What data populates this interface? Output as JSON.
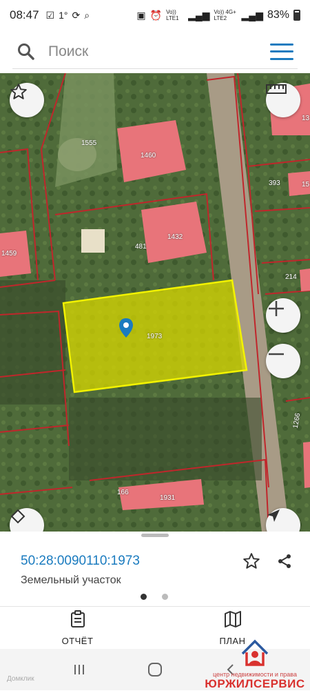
{
  "status_bar": {
    "time": "08:47",
    "temp": "1°",
    "sim1": "Vo)) LTE1",
    "sim2": "Vo)) 4G+ LTE2",
    "battery": "83%"
  },
  "search": {
    "placeholder": "Поиск"
  },
  "map": {
    "parcels": [
      {
        "label": "1555"
      },
      {
        "label": "1460"
      },
      {
        "label": "1432"
      },
      {
        "label": "481"
      },
      {
        "label": "1459"
      },
      {
        "label": "1973"
      },
      {
        "label": "393"
      },
      {
        "label": "214"
      },
      {
        "label": "1266"
      },
      {
        "label": "166"
      },
      {
        "label": "1931"
      },
      {
        "label": "13"
      },
      {
        "label": "15"
      }
    ]
  },
  "selected_object": {
    "cadastral_number": "50:28:0090110:1973",
    "type": "Земельный участок",
    "pages": 2,
    "active_page": 1
  },
  "tabs": [
    {
      "label": "ОТЧЁТ",
      "icon": "report-clipboard-icon"
    },
    {
      "label": "ПЛАН",
      "icon": "map-plan-icon"
    }
  ],
  "watermark": {
    "tagline": "центр недвижимости и права",
    "brand": "ЮРЖИЛСЕРВИС",
    "source": "Домклик"
  },
  "colors": {
    "accent": "#1a7bbf",
    "building": "#e8747a",
    "selected_parcel": "#d8d800",
    "boundary": "#c0262b",
    "brand_red": "#d9322f"
  }
}
